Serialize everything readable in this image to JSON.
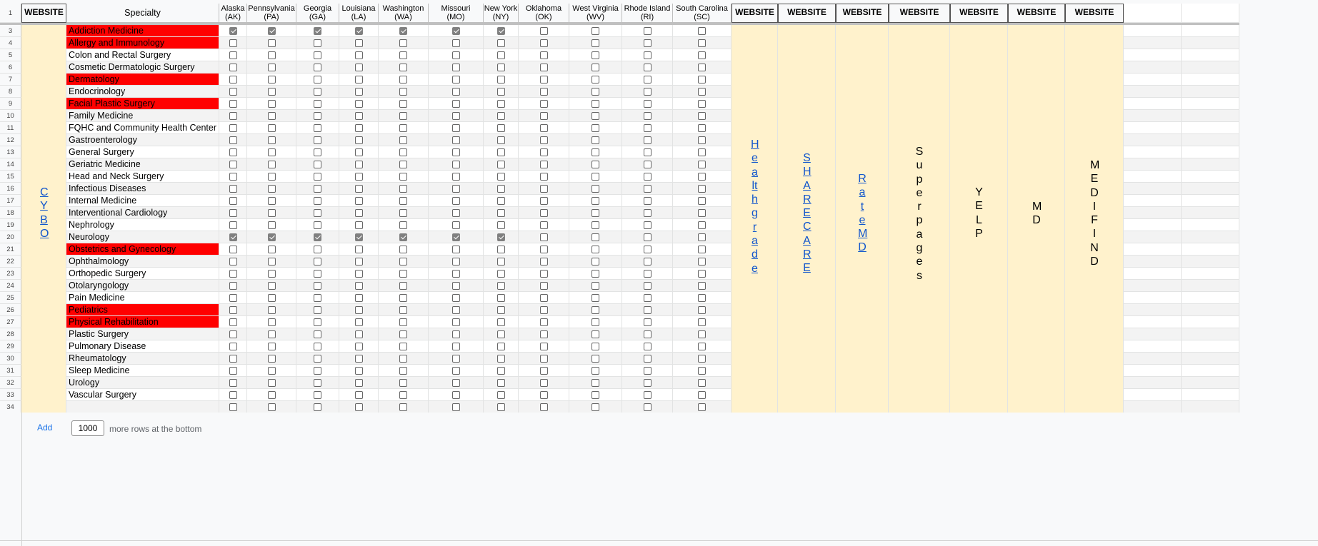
{
  "header": {
    "row_label": "1",
    "website_label": "WEBSITE",
    "specialty_label": "Specialty",
    "states": [
      {
        "name": "Alaska",
        "abbr": "(AK)"
      },
      {
        "name": "Pennsylvania",
        "abbr": "(PA)"
      },
      {
        "name": "Georgia",
        "abbr": "(GA)"
      },
      {
        "name": "Louisiana",
        "abbr": "(LA)"
      },
      {
        "name": "Washington",
        "abbr": "(WA)"
      },
      {
        "name": "Missouri",
        "abbr": "(MO)"
      },
      {
        "name": "New York",
        "abbr": "(NY)"
      },
      {
        "name": "Oklahoma",
        "abbr": "(OK)"
      },
      {
        "name": "West Virginia",
        "abbr": "(WV)"
      },
      {
        "name": "Rhode Island",
        "abbr": "(RI)"
      },
      {
        "name": "South Carolina",
        "abbr": "(SC)"
      }
    ],
    "extra_website_headers": [
      "WEBSITE",
      "WEBSITE",
      "WEBSITE",
      "WEBSITE",
      "WEBSITE",
      "WEBSITE",
      "WEBSITE"
    ]
  },
  "rows": [
    {
      "num": "3",
      "specialty": "Addiction Medicine",
      "highlight": true,
      "checks": [
        1,
        1,
        1,
        1,
        1,
        1,
        1,
        0,
        0,
        0,
        0
      ]
    },
    {
      "num": "4",
      "specialty": "Allergy and Immunology",
      "highlight": true,
      "checks": [
        0,
        0,
        0,
        0,
        0,
        0,
        0,
        0,
        0,
        0,
        0
      ]
    },
    {
      "num": "5",
      "specialty": "Colon and Rectal Surgery",
      "highlight": false,
      "checks": [
        0,
        0,
        0,
        0,
        0,
        0,
        0,
        0,
        0,
        0,
        0
      ]
    },
    {
      "num": "6",
      "specialty": "Cosmetic Dermatologic Surgery",
      "highlight": false,
      "checks": [
        0,
        0,
        0,
        0,
        0,
        0,
        0,
        0,
        0,
        0,
        0
      ]
    },
    {
      "num": "7",
      "specialty": "Dermatology",
      "highlight": true,
      "checks": [
        0,
        0,
        0,
        0,
        0,
        0,
        0,
        0,
        0,
        0,
        0
      ]
    },
    {
      "num": "8",
      "specialty": "Endocrinology",
      "highlight": false,
      "checks": [
        0,
        0,
        0,
        0,
        0,
        0,
        0,
        0,
        0,
        0,
        0
      ]
    },
    {
      "num": "9",
      "specialty": "Facial Plastic Surgery",
      "highlight": true,
      "checks": [
        0,
        0,
        0,
        0,
        0,
        0,
        0,
        0,
        0,
        0,
        0
      ]
    },
    {
      "num": "10",
      "specialty": "Family Medicine",
      "highlight": false,
      "checks": [
        0,
        0,
        0,
        0,
        0,
        0,
        0,
        0,
        0,
        0,
        0
      ]
    },
    {
      "num": "11",
      "specialty": "FQHC and Community Health Center",
      "highlight": false,
      "checks": [
        0,
        0,
        0,
        0,
        0,
        0,
        0,
        0,
        0,
        0,
        0
      ]
    },
    {
      "num": "12",
      "specialty": "Gastroenterology",
      "highlight": false,
      "checks": [
        0,
        0,
        0,
        0,
        0,
        0,
        0,
        0,
        0,
        0,
        0
      ]
    },
    {
      "num": "13",
      "specialty": "General Surgery",
      "highlight": false,
      "checks": [
        0,
        0,
        0,
        0,
        0,
        0,
        0,
        0,
        0,
        0,
        0
      ]
    },
    {
      "num": "14",
      "specialty": "Geriatric Medicine",
      "highlight": false,
      "checks": [
        0,
        0,
        0,
        0,
        0,
        0,
        0,
        0,
        0,
        0,
        0
      ]
    },
    {
      "num": "15",
      "specialty": "Head and Neck Surgery",
      "highlight": false,
      "checks": [
        0,
        0,
        0,
        0,
        0,
        0,
        0,
        0,
        0,
        0,
        0
      ]
    },
    {
      "num": "16",
      "specialty": "Infectious Diseases",
      "highlight": false,
      "checks": [
        0,
        0,
        0,
        0,
        0,
        0,
        0,
        0,
        0,
        0,
        0
      ]
    },
    {
      "num": "17",
      "specialty": "Internal Medicine",
      "highlight": false,
      "checks": [
        0,
        0,
        0,
        0,
        0,
        0,
        0,
        0,
        0,
        0,
        0
      ]
    },
    {
      "num": "18",
      "specialty": "Interventional Cardiology",
      "highlight": false,
      "checks": [
        0,
        0,
        0,
        0,
        0,
        0,
        0,
        0,
        0,
        0,
        0
      ]
    },
    {
      "num": "19",
      "specialty": "Nephrology",
      "highlight": false,
      "checks": [
        0,
        0,
        0,
        0,
        0,
        0,
        0,
        0,
        0,
        0,
        0
      ]
    },
    {
      "num": "20",
      "specialty": "Neurology",
      "highlight": false,
      "checks": [
        1,
        1,
        1,
        1,
        1,
        1,
        1,
        0,
        0,
        0,
        0
      ]
    },
    {
      "num": "21",
      "specialty": "Obstetrics and Gynecology",
      "highlight": true,
      "checks": [
        0,
        0,
        0,
        0,
        0,
        0,
        0,
        0,
        0,
        0,
        0
      ]
    },
    {
      "num": "22",
      "specialty": "Ophthalmology",
      "highlight": false,
      "checks": [
        0,
        0,
        0,
        0,
        0,
        0,
        0,
        0,
        0,
        0,
        0
      ]
    },
    {
      "num": "23",
      "specialty": "Orthopedic Surgery",
      "highlight": false,
      "checks": [
        0,
        0,
        0,
        0,
        0,
        0,
        0,
        0,
        0,
        0,
        0
      ]
    },
    {
      "num": "24",
      "specialty": "Otolaryngology",
      "highlight": false,
      "checks": [
        0,
        0,
        0,
        0,
        0,
        0,
        0,
        0,
        0,
        0,
        0
      ]
    },
    {
      "num": "25",
      "specialty": "Pain Medicine",
      "highlight": false,
      "checks": [
        0,
        0,
        0,
        0,
        0,
        0,
        0,
        0,
        0,
        0,
        0
      ]
    },
    {
      "num": "26",
      "specialty": "Pediatrics",
      "highlight": true,
      "checks": [
        0,
        0,
        0,
        0,
        0,
        0,
        0,
        0,
        0,
        0,
        0
      ]
    },
    {
      "num": "27",
      "specialty": "Physical Rehabilitation",
      "highlight": true,
      "checks": [
        0,
        0,
        0,
        0,
        0,
        0,
        0,
        0,
        0,
        0,
        0
      ]
    },
    {
      "num": "28",
      "specialty": "Plastic Surgery",
      "highlight": false,
      "checks": [
        0,
        0,
        0,
        0,
        0,
        0,
        0,
        0,
        0,
        0,
        0
      ]
    },
    {
      "num": "29",
      "specialty": "Pulmonary Disease",
      "highlight": false,
      "checks": [
        0,
        0,
        0,
        0,
        0,
        0,
        0,
        0,
        0,
        0,
        0
      ]
    },
    {
      "num": "30",
      "specialty": "Rheumatology",
      "highlight": false,
      "checks": [
        0,
        0,
        0,
        0,
        0,
        0,
        0,
        0,
        0,
        0,
        0
      ]
    },
    {
      "num": "31",
      "specialty": "Sleep Medicine",
      "highlight": false,
      "checks": [
        0,
        0,
        0,
        0,
        0,
        0,
        0,
        0,
        0,
        0,
        0
      ]
    },
    {
      "num": "32",
      "specialty": "Urology",
      "highlight": false,
      "checks": [
        0,
        0,
        0,
        0,
        0,
        0,
        0,
        0,
        0,
        0,
        0
      ]
    },
    {
      "num": "33",
      "specialty": "Vascular Surgery",
      "highlight": false,
      "checks": [
        0,
        0,
        0,
        0,
        0,
        0,
        0,
        0,
        0,
        0,
        0
      ]
    },
    {
      "num": "34",
      "specialty": "",
      "highlight": false,
      "checks": [
        0,
        0,
        0,
        0,
        0,
        0,
        0,
        0,
        0,
        0,
        0
      ]
    }
  ],
  "websites_left": {
    "text": "CYBO",
    "link": true
  },
  "websites_right": [
    {
      "text": "Healthgrade",
      "link": true
    },
    {
      "text": "SHARECARE",
      "link": true
    },
    {
      "text": "RateMD",
      "link": true
    },
    {
      "text": "Superpages",
      "link": false
    },
    {
      "text": "YELP",
      "link": false
    },
    {
      "text": "MD",
      "link": false
    },
    {
      "text": "MEDIFIND",
      "link": false
    }
  ],
  "footer": {
    "add_label": "Add",
    "rows_value": "1000",
    "rows_suffix": "more rows at the bottom"
  },
  "colors": {
    "highlight_red": "#ff0000",
    "website_fill": "#fff2cc",
    "link_blue": "#1155cc",
    "checkbox_checked": "#808080"
  }
}
